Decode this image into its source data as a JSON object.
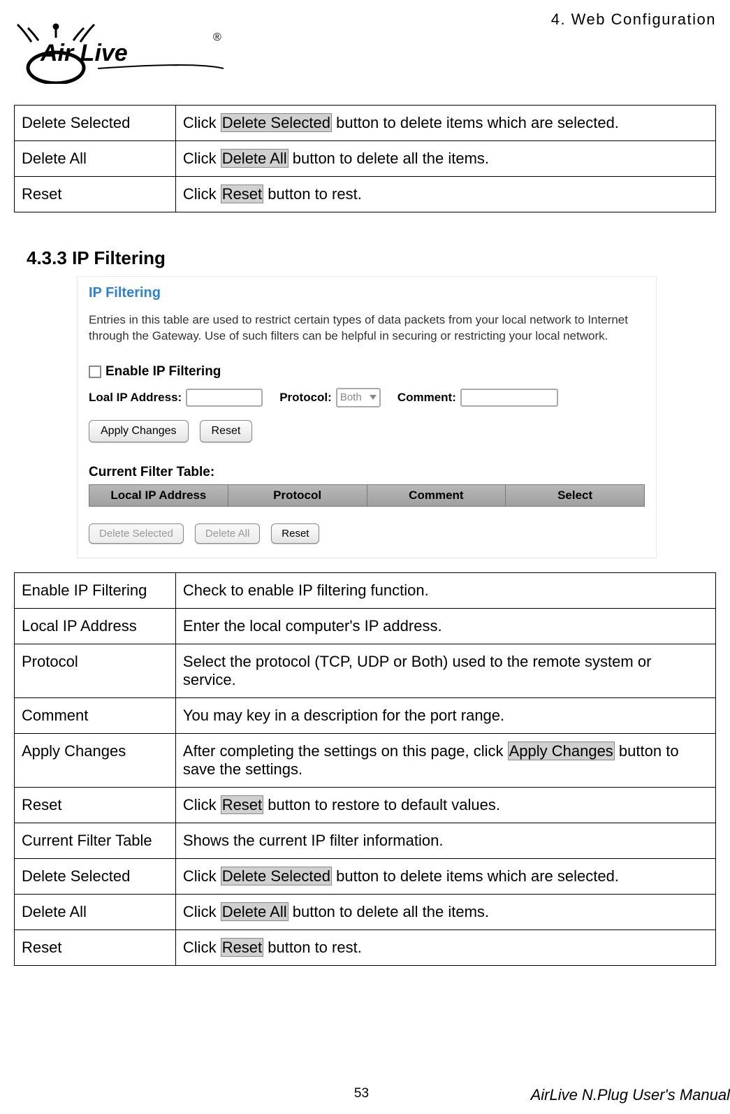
{
  "header": {
    "chapter": "4. Web Configuration",
    "logo_text": "Air Live",
    "logo_r": "®"
  },
  "table1": {
    "rows": [
      {
        "label": "Delete Selected",
        "pre": "Click ",
        "hl": "Delete Selected",
        "post": " button to delete items which are selected."
      },
      {
        "label": "Delete All",
        "pre": "Click ",
        "hl": "Delete All",
        "post": " button to delete all the items."
      },
      {
        "label": "Reset",
        "pre": "Click ",
        "hl": "Reset",
        "post": " button to rest."
      }
    ]
  },
  "section": {
    "number": "4.3.3",
    "title": "IP Filtering"
  },
  "screenshot": {
    "title": "IP Filtering",
    "description": "Entries in this table are used to restrict certain types of data packets from your local network to Internet through the Gateway. Use of such filters can be helpful in securing or restricting your local network.",
    "enable_label": "Enable IP Filtering",
    "local_ip_label": "Loal IP Address:",
    "protocol_label": "Protocol:",
    "protocol_value": "Both",
    "comment_label": "Comment:",
    "apply_btn": "Apply Changes",
    "reset_btn": "Reset",
    "current_table_label": "Current Filter Table:",
    "columns": [
      "Local IP Address",
      "Protocol",
      "Comment",
      "Select"
    ],
    "delete_selected_btn": "Delete Selected",
    "delete_all_btn": "Delete All",
    "reset_btn2": "Reset"
  },
  "table2": {
    "rows": [
      {
        "label": "Enable IP Filtering",
        "desc": "Check to enable IP filtering function."
      },
      {
        "label": "Local IP Address",
        "desc": "Enter the local computer's IP address."
      },
      {
        "label": "Protocol",
        "desc": "Select the protocol (TCP, UDP or Both) used to the remote system or service."
      },
      {
        "label": "Comment",
        "desc": "You may key in a description for the port range."
      },
      {
        "label": "Apply Changes",
        "pre": "After completing the settings on this page, click ",
        "hl": "Apply Changes",
        "post": " button to save the settings."
      },
      {
        "label": "Reset",
        "pre": "Click ",
        "hl": "Reset",
        "post": " button to restore to default values."
      },
      {
        "label": "Current Filter Table",
        "desc": "Shows the current IP filter information."
      },
      {
        "label": "Delete Selected",
        "pre": "Click ",
        "hl": "Delete Selected",
        "post": " button to delete items which are selected."
      },
      {
        "label": "Delete All",
        "pre": "Click ",
        "hl": "Delete All",
        "post": " button to delete all the items."
      },
      {
        "label": "Reset",
        "pre": "Click ",
        "hl": "Reset",
        "post": " button to rest."
      }
    ]
  },
  "footer": {
    "page": "53",
    "manual": "AirLive N.Plug User's Manual"
  }
}
